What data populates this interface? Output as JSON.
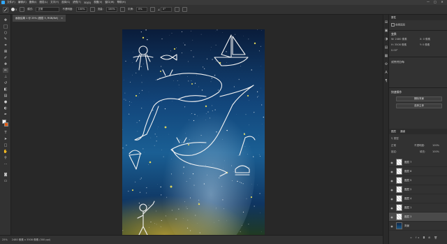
{
  "menubar": {
    "items": [
      "文件(F)",
      "编辑(E)",
      "图像(I)",
      "图层(L)",
      "文字(Y)",
      "选择(S)",
      "滤镜(T)",
      "3D(D)",
      "视图(V)",
      "窗口(W)",
      "帮助(H)"
    ],
    "window_controls": [
      "—",
      "□",
      "✕"
    ]
  },
  "options": {
    "brush_size": "5",
    "mode_label": "模式:",
    "mode_value": "正常",
    "opacity_label": "不透明度:",
    "opacity_value": "100%",
    "flow_label": "流量:",
    "flow_value": "100%",
    "smooth_label": "平滑:",
    "smooth_value": "0%",
    "angle_value": "0°"
  },
  "document": {
    "tab_title": "画板结果 1 @ 25% (图层 3, RGB/8#)",
    "close": "×"
  },
  "status": {
    "zoom": "25%",
    "doc_info": "2480 像素 x 3508 像素 (300 ppi)"
  },
  "properties": {
    "tabs": [
      "属性"
    ],
    "layer_type": "像素图层",
    "transform_header": "变换",
    "w_value": "W: 2480 像素",
    "h_value": "H: 3508 像素",
    "x_value": "X: 0 像素",
    "y_value": "Y: 0 像素",
    "angle": "0.00°",
    "align_header": "对齐并分布",
    "quick_actions_header": "快速操作",
    "remove_bg_label": "删除背景",
    "select_subject_label": "选择主体"
  },
  "layers": {
    "tabs": [
      "图层",
      "通道"
    ],
    "filter_label": "类型",
    "blend_mode": "正常",
    "opacity_label": "不透明度:",
    "opacity_value": "100%",
    "lock_label": "锁定:",
    "fill_label": "填充:",
    "fill_value": "100%",
    "items": [
      {
        "name": "图层 7"
      },
      {
        "name": "图层 6"
      },
      {
        "name": "图层 5"
      },
      {
        "name": "图层 2"
      },
      {
        "name": "图层 4"
      },
      {
        "name": "图层 1"
      },
      {
        "name": "图层 3"
      },
      {
        "name": "背景"
      }
    ]
  },
  "colors": {
    "foreground": "#ffffff",
    "background": "#e05a12",
    "accent": "#31a8ff"
  },
  "icons": {
    "toolbox": [
      "move-icon",
      "marquee-icon",
      "lasso-icon",
      "quick-select-icon",
      "crop-icon",
      "frame-icon",
      "eyedropper-icon",
      "healing-icon",
      "brush-icon",
      "stamp-icon",
      "history-brush-icon",
      "eraser-icon",
      "gradient-icon",
      "blur-icon",
      "dodge-icon",
      "pen-icon",
      "type-icon",
      "path-select-icon",
      "rectangle-icon",
      "hand-icon",
      "zoom-icon",
      "more-icon"
    ]
  }
}
